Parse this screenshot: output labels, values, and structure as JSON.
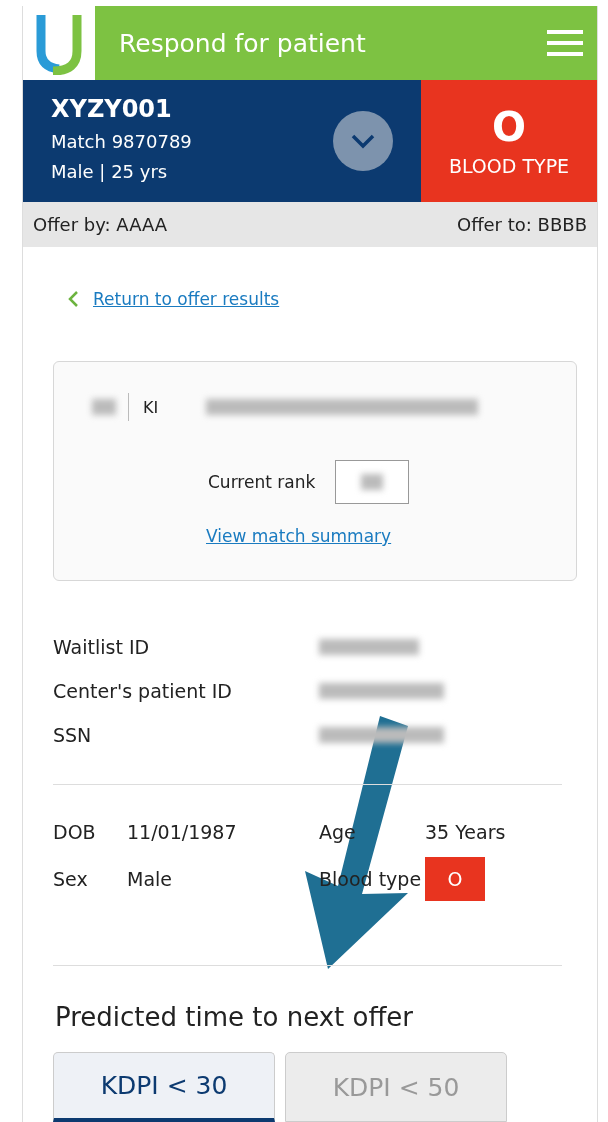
{
  "header": {
    "title": "Respond for patient"
  },
  "patient": {
    "id": "XYZY001",
    "match": "Match 9870789",
    "summary": "Male | 25 yrs",
    "blood_type": "O",
    "blood_type_label": "BLOOD TYPE"
  },
  "offer_bar": {
    "offer_by": "Offer by: AAAA",
    "offer_to": "Offer to: BBBB"
  },
  "back_link": "Return to offer results",
  "match_card": {
    "organ": "KI",
    "rank_label": "Current rank",
    "summary_link": "View match summary"
  },
  "identifiers": [
    {
      "label": "Waitlist ID"
    },
    {
      "label": "Center's patient ID"
    },
    {
      "label": "SSN"
    }
  ],
  "demographics": {
    "dob_label": "DOB",
    "dob": "11/01/1987",
    "age_label": "Age",
    "age": "35 Years",
    "sex_label": "Sex",
    "sex": "Male",
    "blood_type_label": "Blood type",
    "blood_type": "O"
  },
  "prediction": {
    "title": "Predicted time to next offer",
    "tabs": [
      {
        "label": "KDPI < 30",
        "selected": true
      },
      {
        "label": "KDPI < 50",
        "selected": false
      }
    ]
  }
}
